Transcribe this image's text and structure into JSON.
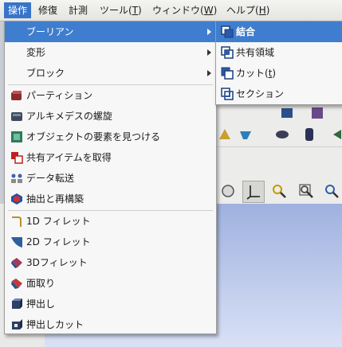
{
  "menubar": {
    "items": [
      {
        "label": "操作",
        "mnemonic": ""
      },
      {
        "label": "修復",
        "mnemonic": ""
      },
      {
        "label": "計測",
        "mnemonic": ""
      },
      {
        "label": "ツール(",
        "mnemonic": "T",
        "suffix": ")"
      },
      {
        "label": "ウィンドウ(",
        "mnemonic": "W",
        "suffix": ")"
      },
      {
        "label": "ヘルプ(",
        "mnemonic": "H",
        "suffix": ")"
      }
    ]
  },
  "menu": {
    "items": [
      {
        "label": "ブーリアン",
        "icon": "none",
        "submenu": true
      },
      {
        "label": "変形",
        "icon": "none",
        "submenu": true
      },
      {
        "label": "ブロック",
        "icon": "none",
        "submenu": true
      },
      {
        "label": "パーティション",
        "icon": "partition-icon"
      },
      {
        "label": "アルキメデスの螺旋",
        "icon": "archimedes-spiral-icon"
      },
      {
        "label": "オブジェクトの要素を見つける",
        "icon": "find-element-icon"
      },
      {
        "label": "共有アイテムを取得",
        "icon": "shared-items-icon"
      },
      {
        "label": "データ転送",
        "icon": "data-transfer-icon"
      },
      {
        "label": "抽出と再構築",
        "icon": "extract-rebuild-icon"
      },
      {
        "label": "1D フィレット",
        "icon": "fillet-1d-icon"
      },
      {
        "label": "2D フィレット",
        "icon": "fillet-2d-icon"
      },
      {
        "label": "3Dフィレット",
        "icon": "fillet-3d-icon"
      },
      {
        "label": "面取り",
        "icon": "chamfer-icon"
      },
      {
        "label": "押出し",
        "icon": "extrusion-icon"
      },
      {
        "label": "押出しカット",
        "icon": "extrusion-cut-icon"
      }
    ]
  },
  "submenu": {
    "items": [
      {
        "label": "結合",
        "icon": "fuse-icon"
      },
      {
        "label": "共有領域",
        "icon": "common-icon"
      },
      {
        "label": "カット(",
        "mnemonic": "t",
        "suffix": ")",
        "icon": "cut-icon"
      },
      {
        "label": "セクション",
        "icon": "section-icon"
      }
    ]
  },
  "colors": {
    "highlight": "#3f7ecf",
    "menubar_active": "#3874c9",
    "viewport_top": "#9fb1df"
  }
}
